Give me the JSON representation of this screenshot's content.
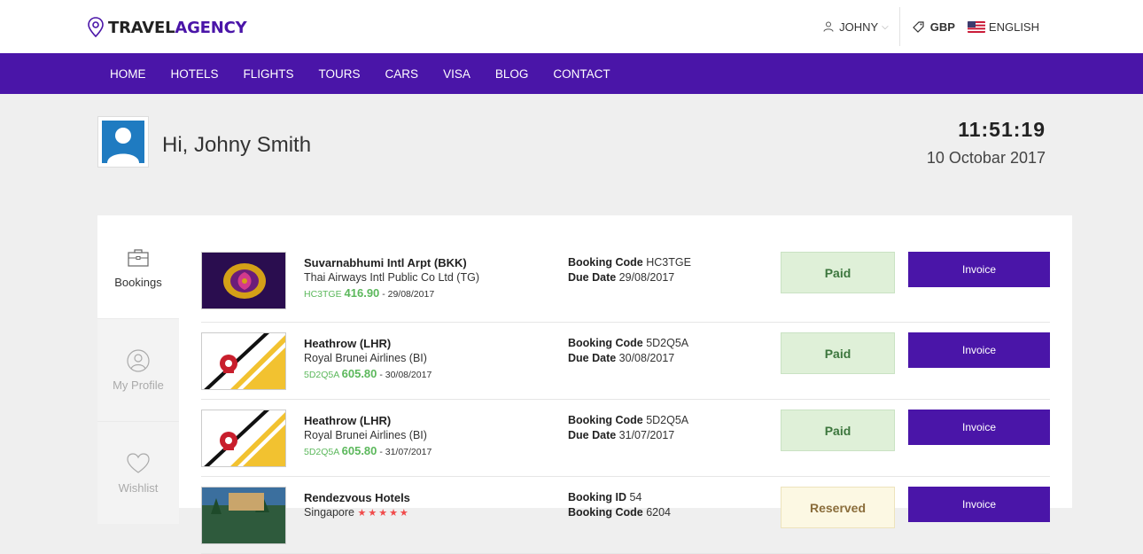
{
  "header": {
    "brand_part1": "TRAVEL",
    "brand_part2": "AGENCY",
    "user": "JOHNY",
    "currency": "GBP",
    "language": "ENGLISH"
  },
  "nav": [
    "HOME",
    "HOTELS",
    "FLIGHTS",
    "TOURS",
    "CARS",
    "VISA",
    "BLOG",
    "CONTACT"
  ],
  "profile": {
    "greeting": "Hi, Johny Smith",
    "time": "11:51:19",
    "date": "10 Octobar 2017"
  },
  "sidebar": [
    {
      "label": "Bookings",
      "icon": "briefcase-icon"
    },
    {
      "label": "My Profile",
      "icon": "user-circle-icon"
    },
    {
      "label": "Wishlist",
      "icon": "heart-icon"
    }
  ],
  "bookings": [
    {
      "place": "Suvarnabhumi Intl Arpt (BKK)",
      "airline": "Thai Airways Intl Public Co Ltd (TG)",
      "code_small": "HC3TGE",
      "price": "416.90",
      "date_small": "- 29/08/2017",
      "code_label": "Booking Code",
      "code": "HC3TGE",
      "due_label": "Due Date",
      "due": "29/08/2017",
      "status": "Paid",
      "invoice": "Invoice"
    },
    {
      "place": "Heathrow (LHR)",
      "airline": "Royal Brunei Airlines (BI)",
      "code_small": "5D2Q5A",
      "price": "605.80",
      "date_small": "- 30/08/2017",
      "code_label": "Booking Code",
      "code": "5D2Q5A",
      "due_label": "Due Date",
      "due": "30/08/2017",
      "status": "Paid",
      "invoice": "Invoice"
    },
    {
      "place": "Heathrow (LHR)",
      "airline": "Royal Brunei Airlines (BI)",
      "code_small": "5D2Q5A",
      "price": "605.80",
      "date_small": "- 31/07/2017",
      "code_label": "Booking Code",
      "code": "5D2Q5A",
      "due_label": "Due Date",
      "due": "31/07/2017",
      "status": "Paid",
      "invoice": "Invoice"
    },
    {
      "place": "Rendezvous Hotels",
      "airline": "Singapore",
      "stars": "★★★★★",
      "code_label": "Booking ID",
      "code": "54",
      "due_label": "Booking Code",
      "due": "6204",
      "status": "Reserved",
      "invoice": "Invoice"
    }
  ]
}
